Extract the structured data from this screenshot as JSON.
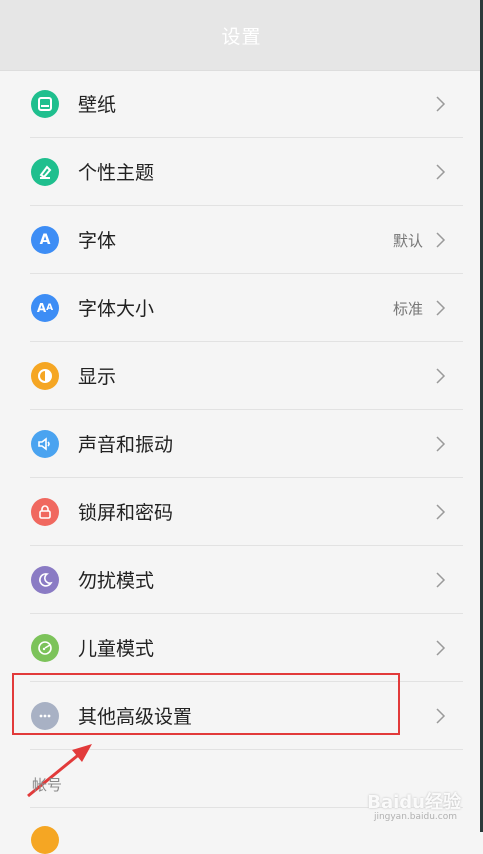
{
  "header": {
    "title": "设置"
  },
  "rows": [
    {
      "label": "壁纸",
      "value": "",
      "icon": "wallpaper-icon",
      "color": "#1fbf8e"
    },
    {
      "label": "个性主题",
      "value": "",
      "icon": "theme-brush-icon",
      "color": "#1fbf8e"
    },
    {
      "label": "字体",
      "value": "默认",
      "icon": "font-a-icon",
      "color": "#3d8df5"
    },
    {
      "label": "字体大小",
      "value": "标准",
      "icon": "font-size-icon",
      "color": "#3d8df5"
    },
    {
      "label": "显示",
      "value": "",
      "icon": "display-icon",
      "color": "#f5a623"
    },
    {
      "label": "声音和振动",
      "value": "",
      "icon": "speaker-icon",
      "color": "#4aa3f0"
    },
    {
      "label": "锁屏和密码",
      "value": "",
      "icon": "lock-icon",
      "color": "#f0685f"
    },
    {
      "label": "勿扰模式",
      "value": "",
      "icon": "moon-icon",
      "color": "#8a7bc4"
    },
    {
      "label": "儿童模式",
      "value": "",
      "icon": "child-icon",
      "color": "#7cc35a"
    },
    {
      "label": "其他高级设置",
      "value": "",
      "icon": "more-dots-icon",
      "color": "#a8b1c4"
    }
  ],
  "section": {
    "title": "帐号"
  },
  "watermark": {
    "brand": "Baidu经验",
    "url": "jingyan.baidu.com"
  }
}
